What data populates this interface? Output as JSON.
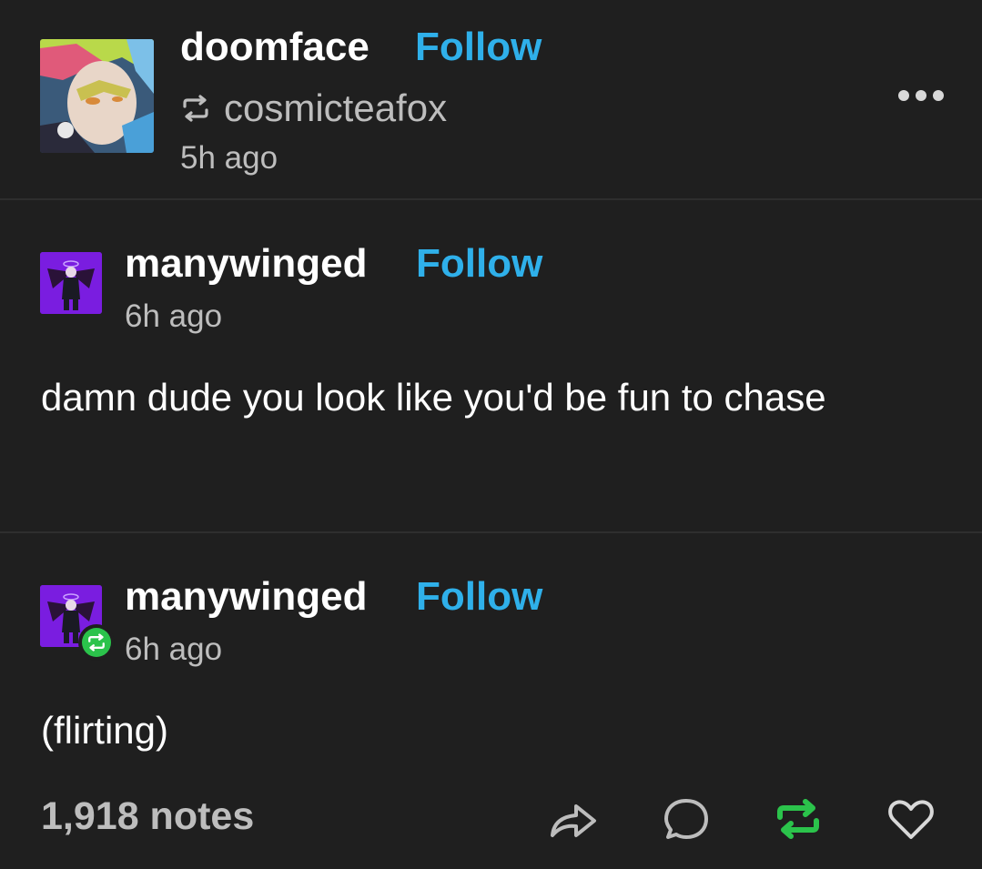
{
  "header": {
    "username": "doomface",
    "follow_label": "Follow",
    "reblogged_from": "cosmicteafox",
    "time": "5h ago",
    "more_icon": "more-horizontal-icon"
  },
  "posts": [
    {
      "username": "manywinged",
      "follow_label": "Follow",
      "time": "6h ago",
      "text": "damn dude you look like you'd be fun to chase"
    },
    {
      "username": "manywinged",
      "follow_label": "Follow",
      "time": "6h ago",
      "text": "(flirting)",
      "badge_icon": "reblog-badge-icon"
    }
  ],
  "footer": {
    "notes": "1,918 notes",
    "actions": [
      "share-icon",
      "reply-icon",
      "reblog-icon",
      "like-icon"
    ]
  },
  "colors": {
    "background": "#1f1f1f",
    "follow": "#2fb0ea",
    "secondary_text": "#bdbdbd",
    "reblog_green": "#2bc34b",
    "divider": "#2e2e2e"
  }
}
